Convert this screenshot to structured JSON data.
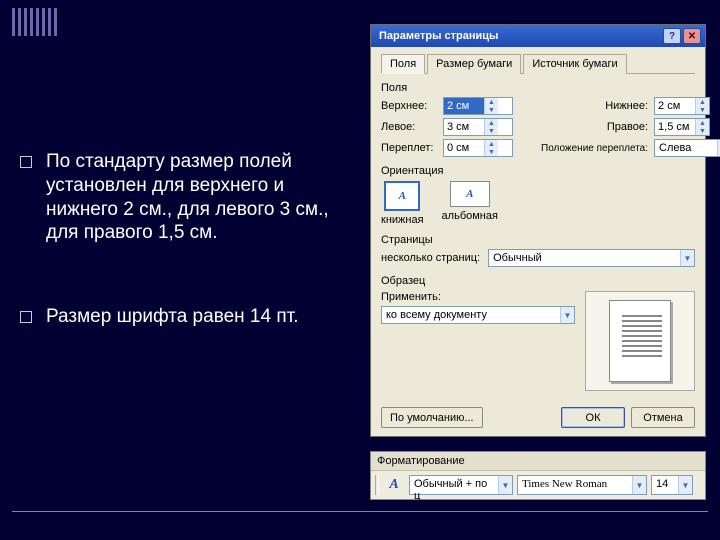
{
  "bullets": [
    "По стандарту размер полей установлен для верхнего и нижнего 2 см., для левого 3 см., для правого 1,5 см.",
    "Размер шрифта равен 14 пт."
  ],
  "dialog": {
    "title": "Параметры страницы",
    "tabs": [
      "Поля",
      "Размер бумаги",
      "Источник бумаги"
    ],
    "margins_label": "Поля",
    "fields": {
      "top_label": "Верхнее:",
      "top_value": "2 см",
      "bottom_label": "Нижнее:",
      "bottom_value": "2 см",
      "left_label": "Левое:",
      "left_value": "3 см",
      "right_label": "Правое:",
      "right_value": "1,5 см",
      "gutter_label": "Переплет:",
      "gutter_value": "0 см",
      "gutter_pos_label": "Положение переплета:",
      "gutter_pos_value": "Слева"
    },
    "orientation_label": "Ориентация",
    "orientation": {
      "portrait": "книжная",
      "landscape": "альбомная"
    },
    "pages_label": "Страницы",
    "pages_multi_label": "несколько страниц:",
    "pages_multi_value": "Обычный",
    "sample_label": "Образец",
    "apply_label": "Применить:",
    "apply_value": "ко всему документу",
    "default_btn": "По умолчанию...",
    "ok_btn": "ОК",
    "cancel_btn": "Отмена"
  },
  "formatting": {
    "title": "Форматирование",
    "style": "Обычный + по ц",
    "font": "Times New Roman",
    "size": "14"
  }
}
